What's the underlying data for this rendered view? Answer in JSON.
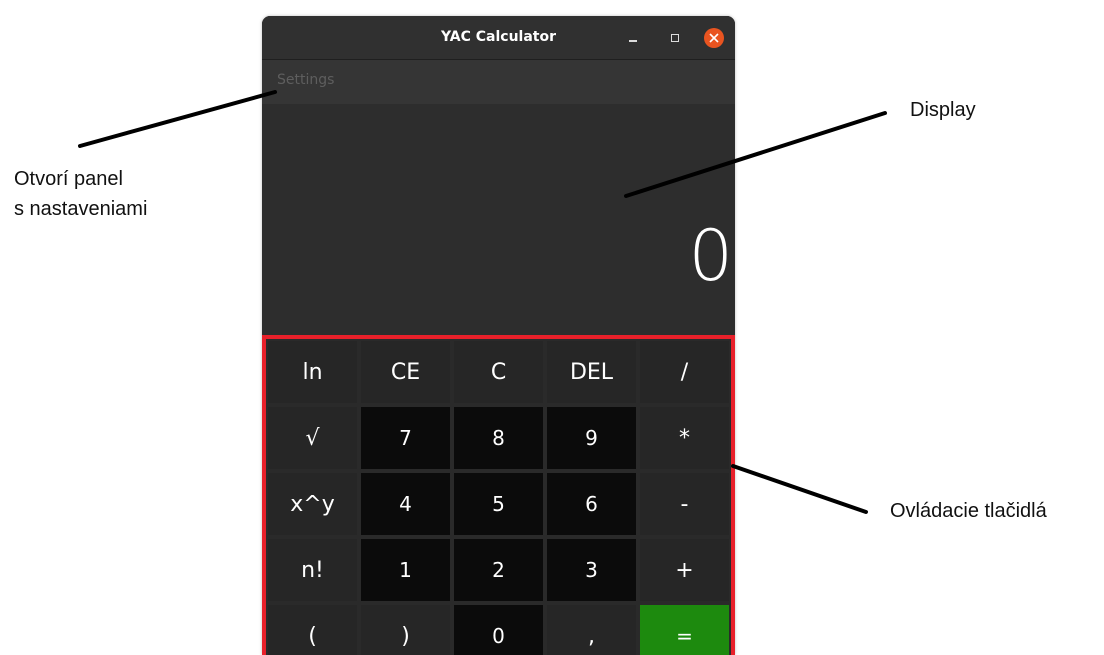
{
  "window": {
    "title": "YAC Calculator",
    "menu_settings": "Settings"
  },
  "display": {
    "value": "0"
  },
  "keypad": {
    "keys": [
      {
        "label": "ln",
        "kind": "op",
        "name": "ln-key"
      },
      {
        "label": "CE",
        "kind": "op",
        "name": "clear-entry-key"
      },
      {
        "label": "C",
        "kind": "op",
        "name": "clear-key"
      },
      {
        "label": "DEL",
        "kind": "op",
        "name": "delete-key"
      },
      {
        "label": "/",
        "kind": "op",
        "name": "divide-key"
      },
      {
        "label": "√",
        "kind": "op",
        "name": "sqrt-key"
      },
      {
        "label": "7",
        "kind": "num",
        "name": "digit-7-key"
      },
      {
        "label": "8",
        "kind": "num",
        "name": "digit-8-key"
      },
      {
        "label": "9",
        "kind": "num",
        "name": "digit-9-key"
      },
      {
        "label": "*",
        "kind": "op",
        "name": "multiply-key"
      },
      {
        "label": "x^y",
        "kind": "op",
        "name": "power-key"
      },
      {
        "label": "4",
        "kind": "num",
        "name": "digit-4-key"
      },
      {
        "label": "5",
        "kind": "num",
        "name": "digit-5-key"
      },
      {
        "label": "6",
        "kind": "num",
        "name": "digit-6-key"
      },
      {
        "label": "-",
        "kind": "op",
        "name": "subtract-key"
      },
      {
        "label": "n!",
        "kind": "op",
        "name": "factorial-key"
      },
      {
        "label": "1",
        "kind": "num",
        "name": "digit-1-key"
      },
      {
        "label": "2",
        "kind": "num",
        "name": "digit-2-key"
      },
      {
        "label": "3",
        "kind": "num",
        "name": "digit-3-key"
      },
      {
        "label": "+",
        "kind": "op",
        "name": "add-key"
      },
      {
        "label": "(",
        "kind": "op",
        "name": "open-paren-key"
      },
      {
        "label": ")",
        "kind": "op",
        "name": "close-paren-key"
      },
      {
        "label": "0",
        "kind": "num",
        "name": "digit-0-key"
      },
      {
        "label": ",",
        "kind": "op",
        "name": "decimal-comma-key"
      },
      {
        "label": "=",
        "kind": "equals",
        "name": "equals-key"
      }
    ]
  },
  "annotations": {
    "settings_line1": "Otvorí panel",
    "settings_line2": "s nastaveniami",
    "display": "Display",
    "buttons": "Ovládacie tlačidlá"
  },
  "colors": {
    "highlight_border": "#e8202a",
    "close_button": "#e95420",
    "equals_button": "#1d8a0e"
  }
}
